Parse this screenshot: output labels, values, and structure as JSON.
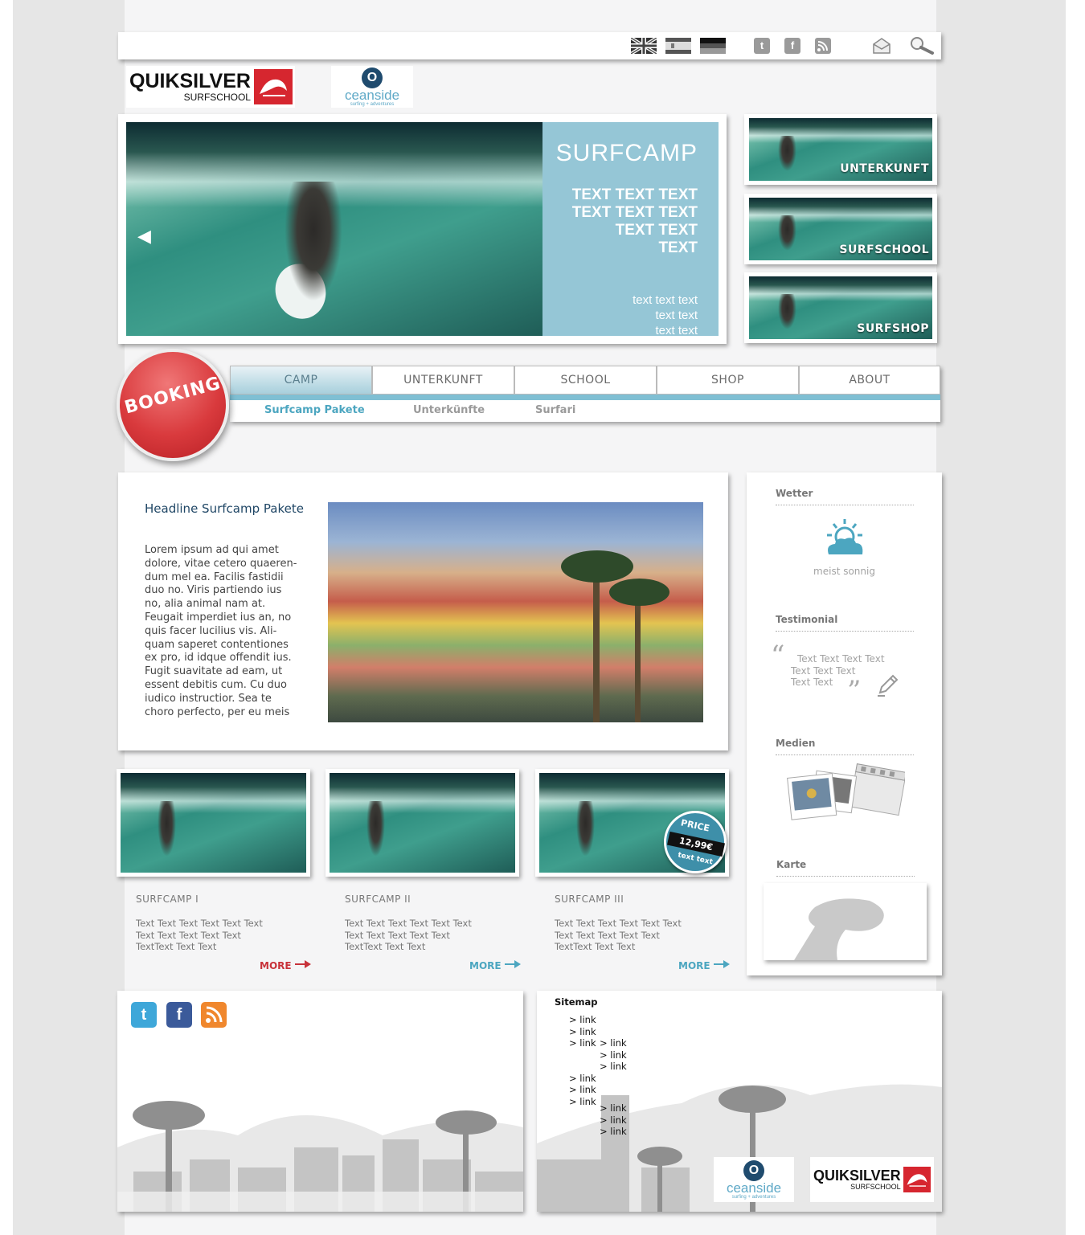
{
  "colors": {
    "accent": "#4ca6c0",
    "booking_red": "#d93a3d",
    "hero_panel": "#95c6d6",
    "more_red": "#c8323a",
    "more_blue": "#4ca6c0"
  },
  "topbar": {
    "flags": [
      "flag-uk",
      "flag-spain",
      "flag-germany"
    ],
    "social_icons": [
      "twitter-icon",
      "facebook-icon",
      "rss-icon"
    ],
    "twitter_glyph": "t",
    "facebook_glyph": "f",
    "utility_icons": [
      "mail-icon",
      "search-icon"
    ]
  },
  "logos": {
    "quiksilver": {
      "name": "QUIKSILVER",
      "sub": "SURFSCHOOL"
    },
    "oceanside": {
      "letter": "O",
      "word": "ceanside",
      "tagline": "surfing + adventures"
    }
  },
  "hero": {
    "title": "SURFCAMP",
    "lines": [
      "TEXT TEXT TEXT",
      "TEXT TEXT TEXT",
      "TEXT TEXT",
      "TEXT"
    ],
    "small_lines": [
      "text text text",
      "text text",
      "text text"
    ],
    "prev_arrow": "◀"
  },
  "thumbs": [
    {
      "label": "UNTERKUNFT"
    },
    {
      "label": "SURFSCHOOL"
    },
    {
      "label": "SURFSHOP"
    }
  ],
  "booking": {
    "label": "BOOKING"
  },
  "nav": {
    "tabs": [
      {
        "label": "CAMP",
        "active": true
      },
      {
        "label": "UNTERKUNFT",
        "active": false
      },
      {
        "label": "SCHOOL",
        "active": false
      },
      {
        "label": "SHOP",
        "active": false
      },
      {
        "label": "ABOUT",
        "active": false
      }
    ],
    "subnav": [
      {
        "label": "Surfcamp Pakete",
        "active": true
      },
      {
        "label": "Unterkünfte",
        "active": false
      },
      {
        "label": "Surfari",
        "active": false
      }
    ]
  },
  "article": {
    "headline": "Headline Surfcamp Pakete",
    "lines": [
      "Lorem ipsum ad qui amet",
      "dolore, vitae cetero quaeren-",
      "dum mel ea. Facilis fastidii",
      "duo no. Viris partiendo ius",
      "no, alia animal nam at.",
      "Feugait imperdiet ius an, no",
      "quis facer lucilius vis. Ali-",
      "quam saperet contentiones",
      "ex pro, id idque offendit ius.",
      "Fugit suavitate ad eam, ut",
      "essent debitis cum. Cu duo",
      "iudico instructior. Sea te",
      "choro perfecto, per eu meis"
    ]
  },
  "sidebar": {
    "wetter": {
      "title": "Wetter",
      "caption": "meist sonnig"
    },
    "testimonial": {
      "title": "Testimonial",
      "open_quote": "“",
      "close_quote": "”",
      "lines": [
        "Text Text Text Text",
        "Text Text Text",
        "Text Text"
      ]
    },
    "medien": {
      "title": "Medien"
    },
    "karte": {
      "title": "Karte"
    }
  },
  "surfcamps": [
    {
      "title": "SURFCAMP I",
      "lines": [
        "Text Text Text Text Text Text",
        "Text Text Text Text Text",
        "TextText Text Text"
      ],
      "more": "MORE",
      "more_color": "red"
    },
    {
      "title": "SURFCAMP II",
      "lines": [
        "Text Text Text Text Text Text",
        "Text Text Text Text Text",
        "TextText Text Text"
      ],
      "more": "MORE",
      "more_color": "blue"
    },
    {
      "title": "SURFCAMP III",
      "lines": [
        "Text Text Text Text Text Text",
        "Text Text Text Text Text",
        "TextText Text Text"
      ],
      "more": "MORE",
      "more_color": "blue",
      "price": {
        "label": "PRICE",
        "value": "12,99€",
        "sub": "text text"
      }
    }
  ],
  "footer": {
    "social": [
      {
        "icon": "twitter-icon",
        "glyph": "t",
        "color": "#3ea7d9"
      },
      {
        "icon": "facebook-icon",
        "glyph": "f",
        "color": "#3b5a9a"
      },
      {
        "icon": "rss-icon",
        "glyph": ")",
        "color": "#f0872d"
      }
    ],
    "sitemap": {
      "title": "Sitemap",
      "link_label": "> link"
    }
  }
}
